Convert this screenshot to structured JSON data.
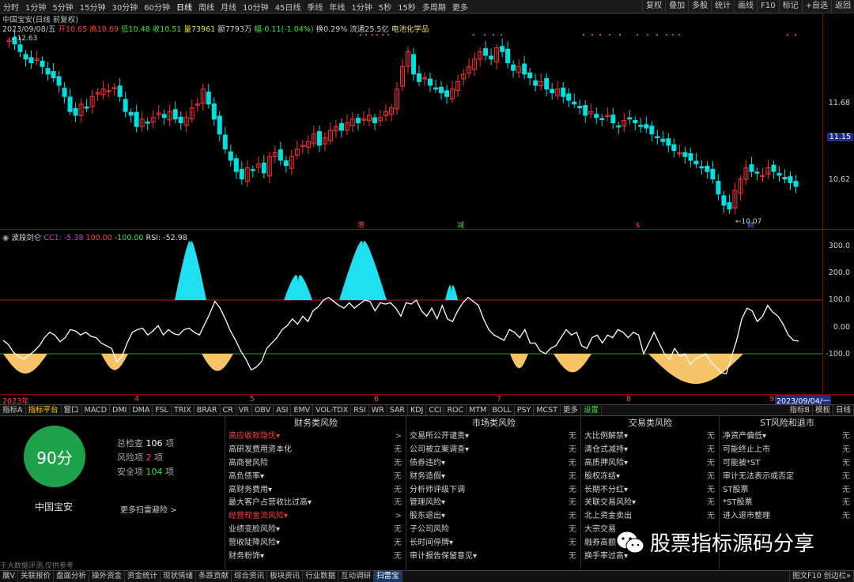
{
  "topbar": {
    "periods": [
      "分时",
      "1分钟",
      "5分钟",
      "15分钟",
      "30分钟",
      "60分钟",
      "日线",
      "周线",
      "月线",
      "10分钟",
      "45日线",
      "季线",
      "年线",
      "1分钟",
      "5秒",
      "15秒",
      "多周期",
      "更多"
    ],
    "active_period": "日线",
    "right_buttons": [
      "复权",
      "叠加",
      "多股",
      "统计",
      "画线",
      "F10",
      "标记",
      "+自选",
      "返回"
    ]
  },
  "chart_header": {
    "title": "中国宝安(日线 前复权)",
    "date": "2023/09/08/五",
    "open": "开10.65",
    "high": "高10.69",
    "low": "低10.48",
    "close": "收10.51",
    "volume": "量73961",
    "amount": "额7793万",
    "change": "幅-0.11(-1.04%)",
    "turnover": "换0.29%",
    "float": "流通25.5亿",
    "concept": "电池化学品",
    "max_marker": "12.63",
    "min_marker": "10.07",
    "flag_markers": [
      "港",
      "减",
      "$",
      "财"
    ]
  },
  "price_axis": [
    "11.68",
    "11.15",
    "10.62"
  ],
  "price_axis_current": "11.15",
  "indicator_header": {
    "name": "波段剑仑",
    "cc1": "CC1: -5.38",
    "l100": "100.00",
    "lm100": "-100.00",
    "rsi": "RSI: -52.98"
  },
  "indicator_axis": [
    "300.0",
    "200.0",
    "100.0",
    "0.00",
    "-100.0"
  ],
  "time_axis": {
    "labels": [
      "2023年",
      "4",
      "5",
      "6",
      "7",
      "8",
      "9"
    ],
    "end_date": "2023/09/04/一"
  },
  "indicator_tabs": [
    "指标A",
    "指标平台",
    "窗口",
    "MACD",
    "DMI",
    "DMA",
    "FSL",
    "TRIX",
    "BRAR",
    "CR",
    "VR",
    "OBV",
    "ASI",
    "EMV",
    "VOL-TDX",
    "RSI",
    "WR",
    "SAR",
    "KDJ",
    "CCI",
    "ROC",
    "MTM",
    "BOLL",
    "PSY",
    "MCST",
    "更多",
    "设置"
  ],
  "indicator_tabs_right": [
    "指标B",
    "模板",
    "日线"
  ],
  "score": {
    "value": "90分",
    "stock_name": "中国宝安",
    "total_label": "总检查",
    "total_value": "106",
    "total_unit": "项",
    "risk_label": "风险项",
    "risk_value": "2",
    "risk_unit": "项",
    "safe_label": "安全项",
    "safe_value": "104",
    "safe_unit": "项",
    "more_link": "更多扫雷避险 >",
    "footnote": "于大数据评测,仅供参考"
  },
  "risk_columns": [
    {
      "title": "财务类风险",
      "items": [
        {
          "label": "高应收款隐忧▾",
          "value": ">",
          "red": true
        },
        {
          "label": "高研发费用资本化",
          "value": "无",
          "red": false
        },
        {
          "label": "高商誉风险",
          "value": "无",
          "red": false
        },
        {
          "label": "高负债率▾",
          "value": "无",
          "red": false
        },
        {
          "label": "高财务费用▾",
          "value": "无",
          "red": false
        },
        {
          "label": "最大客户占营收比过高▾",
          "value": "无",
          "red": false
        },
        {
          "label": "经营现金流风险▾",
          "value": ">",
          "red": true
        },
        {
          "label": "业绩变脸风险▾",
          "value": "无",
          "red": false
        },
        {
          "label": "营收陡降风险▾",
          "value": "无",
          "red": false
        },
        {
          "label": "财务粉饰▾",
          "value": "无",
          "red": false
        }
      ]
    },
    {
      "title": "市场类风险",
      "items": [
        {
          "label": "交易所公开谴责▾",
          "value": "无",
          "red": false
        },
        {
          "label": "公司被立案调查▾",
          "value": "无",
          "red": false
        },
        {
          "label": "债券违约▾",
          "value": "无",
          "red": false
        },
        {
          "label": "财务造假▾",
          "value": "无",
          "red": false
        },
        {
          "label": "分析师评级下调",
          "value": "无",
          "red": false
        },
        {
          "label": "管理风险▾",
          "value": "无",
          "red": false
        },
        {
          "label": "股东退出▾",
          "value": "无",
          "red": false
        },
        {
          "label": "子公司风险",
          "value": "无",
          "red": false
        },
        {
          "label": "长时间停牌▾",
          "value": "无",
          "red": false
        },
        {
          "label": "审计报告保留意见▾",
          "value": "无",
          "red": false
        }
      ]
    },
    {
      "title": "交易类风险",
      "items": [
        {
          "label": "大比例解禁▾",
          "value": "无",
          "red": false
        },
        {
          "label": "清仓式减持▾",
          "value": "无",
          "red": false
        },
        {
          "label": "高质押风险▾",
          "value": "无",
          "red": false
        },
        {
          "label": "股权冻结▾",
          "value": "无",
          "red": false
        },
        {
          "label": "长期不分红▾",
          "value": "无",
          "red": false
        },
        {
          "label": "关联交易风险▾",
          "value": "无",
          "red": false
        },
        {
          "label": "北上资金卖出",
          "value": "无",
          "red": false
        },
        {
          "label": "大宗交易",
          "value": "",
          "red": false
        },
        {
          "label": "融券高额",
          "value": "",
          "red": false
        },
        {
          "label": "换手率过高▾",
          "value": "",
          "red": false
        }
      ]
    },
    {
      "title": "ST风险和退市",
      "items": [
        {
          "label": "净资产偏低▾",
          "value": "无",
          "red": false
        },
        {
          "label": "可能终止上市",
          "value": "无",
          "red": false
        },
        {
          "label": "可能被*ST",
          "value": "无",
          "red": false
        },
        {
          "label": "审计无法表示或否定",
          "value": "无",
          "red": false
        },
        {
          "label": "ST股票",
          "value": "无",
          "red": false
        },
        {
          "label": "*ST股票",
          "value": "无",
          "red": false
        },
        {
          "label": "进入退市整理",
          "value": "无",
          "red": false
        },
        {
          "label": "",
          "value": "",
          "red": false
        },
        {
          "label": "",
          "value": "",
          "red": false
        },
        {
          "label": "",
          "value": "",
          "red": false
        }
      ]
    }
  ],
  "watermark": "股票指标源码分享",
  "bottombar": {
    "items": [
      "展V",
      "关联报价",
      "盘面分析",
      "操外资金",
      "资金统计",
      "现状情绪",
      "条跌贡献",
      "综合资讯",
      "板块资讯",
      "行业数据",
      "互动调研",
      "扫雷宝"
    ],
    "active": "扫雷宝",
    "right": "图文F10 创边栏»"
  },
  "colors": {
    "up": "#ff3030",
    "down": "#00e0e0",
    "fill_up": "#1ee0f0",
    "fill_down": "#f7c367",
    "score_green": "#1fa34a"
  }
}
